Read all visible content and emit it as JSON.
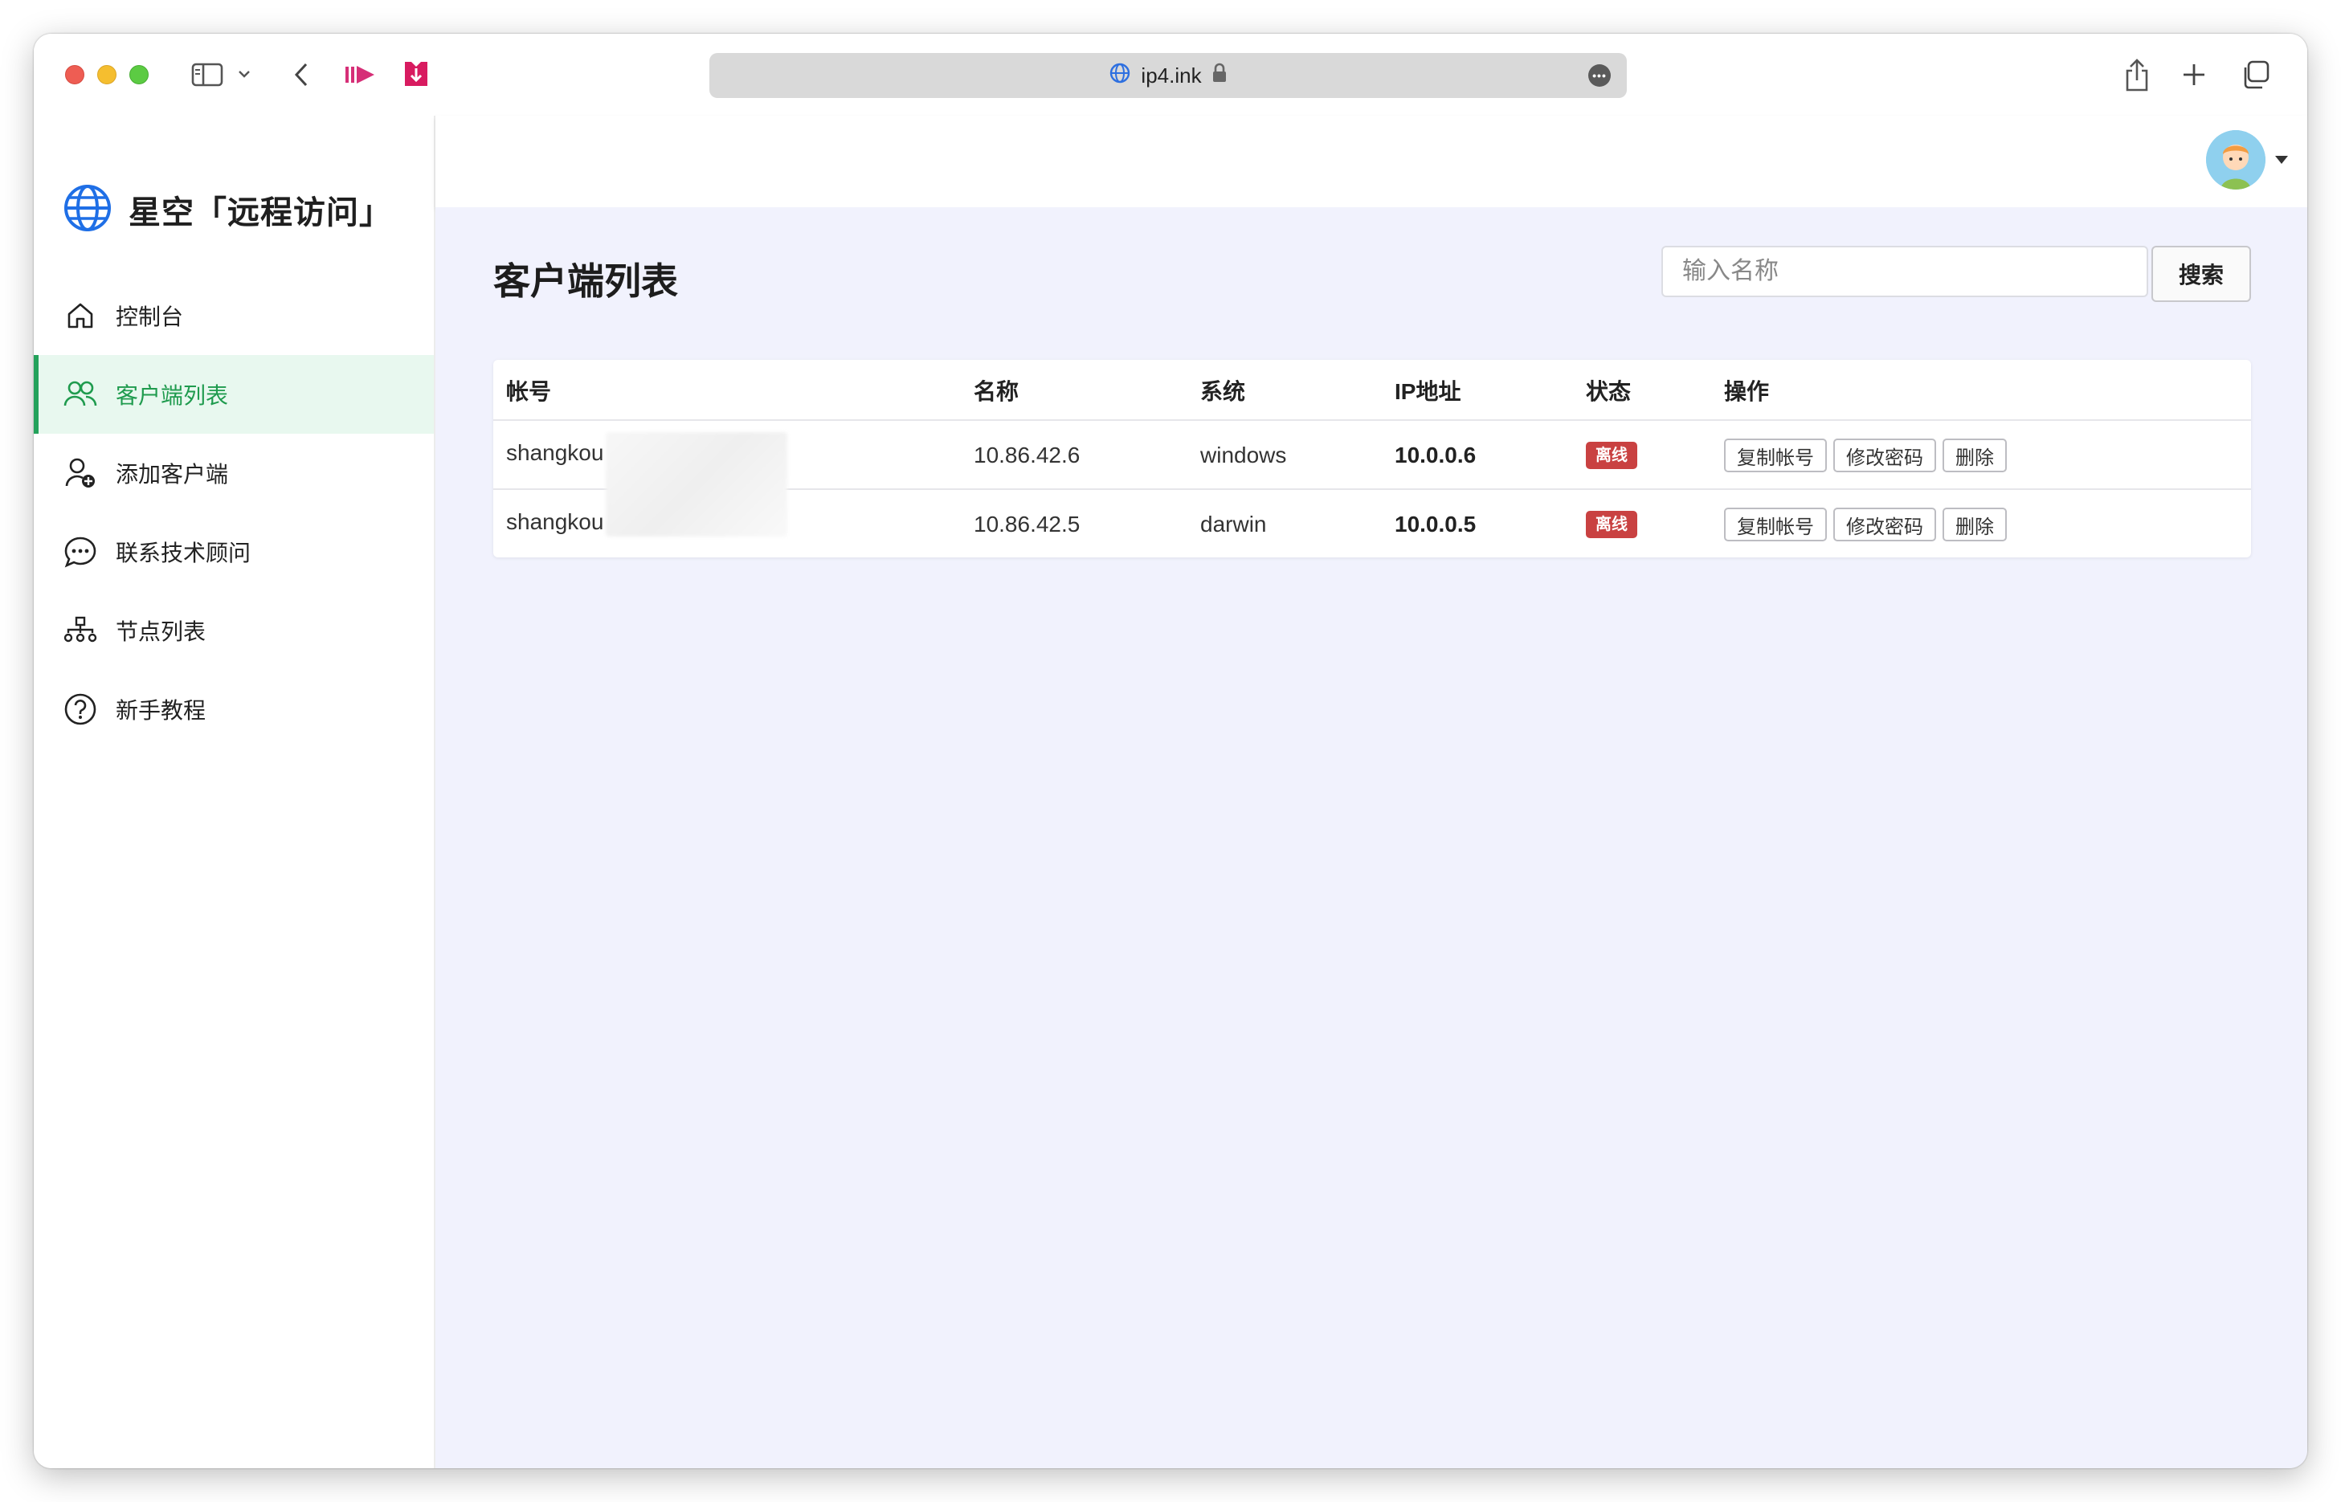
{
  "browser": {
    "url": "ip4.ink"
  },
  "sidebar": {
    "brand": "星空「远程访问」",
    "items": [
      {
        "label": "控制台",
        "icon": "home-icon",
        "active": false
      },
      {
        "label": "客户端列表",
        "icon": "users-icon",
        "active": true
      },
      {
        "label": "添加客户端",
        "icon": "user-add-icon",
        "active": false
      },
      {
        "label": "联系技术顾问",
        "icon": "chat-icon",
        "active": false
      },
      {
        "label": "节点列表",
        "icon": "network-icon",
        "active": false
      },
      {
        "label": "新手教程",
        "icon": "help-icon",
        "active": false
      }
    ]
  },
  "main": {
    "title": "客户端列表",
    "search": {
      "placeholder": "输入名称",
      "value": "",
      "button": "搜索"
    },
    "table": {
      "headers": [
        "帐号",
        "名称",
        "系统",
        "IP地址",
        "状态",
        "操作"
      ],
      "rows": [
        {
          "account": "shangkou",
          "name": "10.86.42.6",
          "system": "windows",
          "ip": "10.0.0.6",
          "status": "离线"
        },
        {
          "account": "shangkou",
          "name": "10.86.42.5",
          "system": "darwin",
          "ip": "10.0.0.5",
          "status": "离线"
        }
      ],
      "actions": [
        "复制帐号",
        "修改密码",
        "删除"
      ]
    }
  },
  "colors": {
    "accent_green": "#24a25b",
    "active_bg": "#e8f8ef",
    "content_bg": "#f1f2fd",
    "status_offline": "#c94141"
  }
}
